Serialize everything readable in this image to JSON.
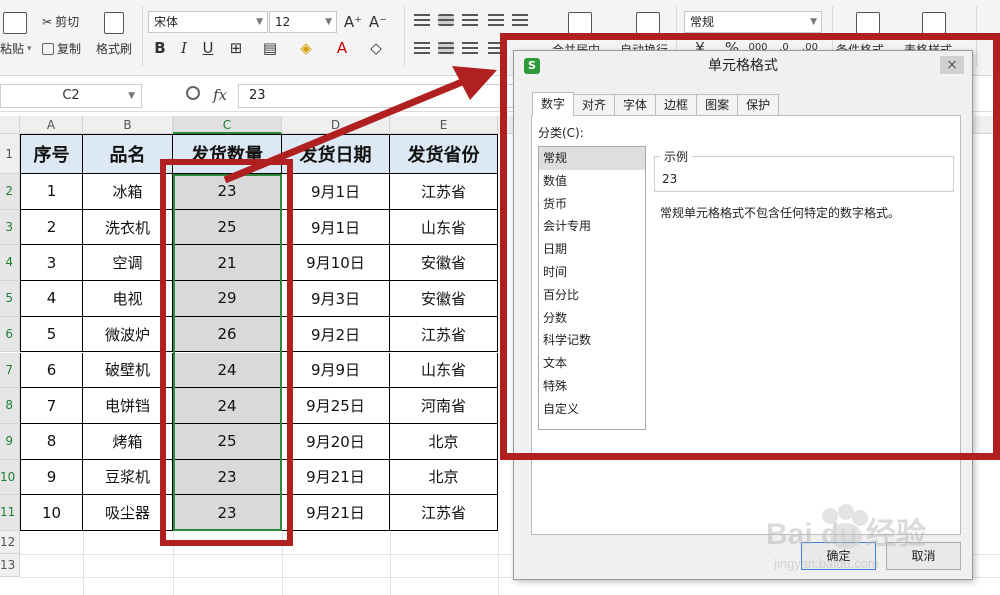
{
  "ribbon": {
    "paste_label": "粘贴",
    "cut_label": "剪切",
    "copy_label": "复制",
    "format_painter_label": "格式刷",
    "font_name": "宋体",
    "font_size": "12",
    "font_grow_icon": "A⁺",
    "font_shrink_icon": "A⁻",
    "bold": "B",
    "italic": "I",
    "underline": "U",
    "merge_label": "合并居中",
    "wrap_label": "自动换行",
    "number_format": "常规",
    "percent": "%",
    "cond_format_label": "条件格式",
    "table_style_label": "表格样式"
  },
  "formula_bar": {
    "name_box": "C2",
    "fx": "fx",
    "value": "23"
  },
  "sheet": {
    "col_headers": [
      "A",
      "B",
      "C",
      "D",
      "E"
    ],
    "row_numbers": [
      "1",
      "2",
      "3",
      "4",
      "5",
      "6",
      "7",
      "8",
      "9",
      "10",
      "11",
      "12",
      "13"
    ],
    "header": [
      "序号",
      "品名",
      "发货数量",
      "发货日期",
      "发货省份"
    ],
    "rows": [
      [
        "1",
        "冰箱",
        "23",
        "9月1日",
        "江苏省"
      ],
      [
        "2",
        "洗衣机",
        "25",
        "9月1日",
        "山东省"
      ],
      [
        "3",
        "空调",
        "21",
        "9月10日",
        "安徽省"
      ],
      [
        "4",
        "电视",
        "29",
        "9月3日",
        "安徽省"
      ],
      [
        "5",
        "微波炉",
        "26",
        "9月2日",
        "江苏省"
      ],
      [
        "6",
        "破壁机",
        "24",
        "9月9日",
        "山东省"
      ],
      [
        "7",
        "电饼铛",
        "24",
        "9月25日",
        "河南省"
      ],
      [
        "8",
        "烤箱",
        "25",
        "9月20日",
        "北京"
      ],
      [
        "9",
        "豆浆机",
        "23",
        "9月21日",
        "北京"
      ],
      [
        "10",
        "吸尘器",
        "23",
        "9月21日",
        "江苏省"
      ]
    ]
  },
  "dialog": {
    "logo": "S",
    "title": "单元格格式",
    "close": "×",
    "tabs": [
      "数字",
      "对齐",
      "字体",
      "边框",
      "图案",
      "保护"
    ],
    "category_label": "分类(C):",
    "categories": [
      "常规",
      "数值",
      "货币",
      "会计专用",
      "日期",
      "时间",
      "百分比",
      "分数",
      "科学记数",
      "文本",
      "特殊",
      "自定义"
    ],
    "sample_title": "示例",
    "sample_value": "23",
    "description": "常规单元格格式不包含任何特定的数字格式。",
    "ok": "确定",
    "cancel": "取消"
  },
  "colors": {
    "annotation_red": "#b02020",
    "header_fill": "#dce8f3",
    "selection_fill": "#d9d9d9",
    "selection_green": "#2e8b3e"
  },
  "watermark": {
    "text": "Bai du 经验",
    "url": "jingyan.baidu.com"
  }
}
